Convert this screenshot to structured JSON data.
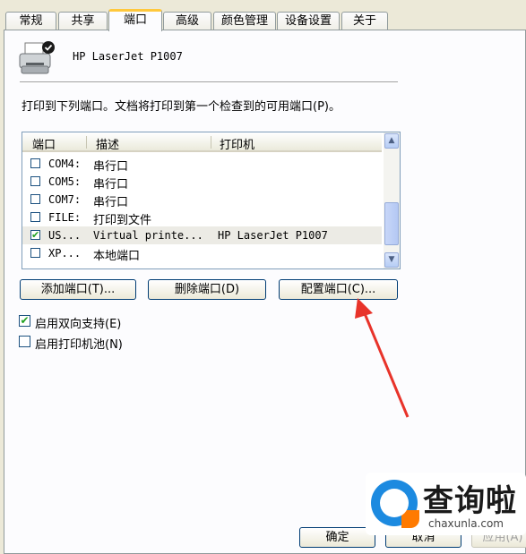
{
  "tabs": [
    {
      "label": "常规"
    },
    {
      "label": "共享"
    },
    {
      "label": "端口",
      "active": true
    },
    {
      "label": "高级"
    },
    {
      "label": "颜色管理"
    },
    {
      "label": "设备设置"
    },
    {
      "label": "关于"
    }
  ],
  "printer": {
    "name": "HP LaserJet P1007",
    "icon": "printer-icon"
  },
  "description": "打印到下列端口。文档将打印到第一个检查到的可用端口(P)。",
  "port_list": {
    "columns": [
      "端口",
      "描述",
      "打印机"
    ],
    "rows": [
      {
        "checked": false,
        "port": "COM4:",
        "description": "串行口",
        "printer": ""
      },
      {
        "checked": false,
        "port": "COM5:",
        "description": "串行口",
        "printer": ""
      },
      {
        "checked": false,
        "port": "COM7:",
        "description": "串行口",
        "printer": ""
      },
      {
        "checked": false,
        "port": "FILE:",
        "description": "打印到文件",
        "printer": ""
      },
      {
        "checked": true,
        "port": "US...",
        "description": "Virtual printe...",
        "printer": "HP LaserJet P1007"
      },
      {
        "checked": false,
        "port": "XP...",
        "description": "本地端口",
        "printer": ""
      }
    ]
  },
  "buttons": {
    "add_port": "添加端口(T)...",
    "delete_port": "删除端口(D)",
    "configure_port": "配置端口(C)..."
  },
  "options": {
    "bidirectional": {
      "label": "启用双向支持(E)",
      "checked": true
    },
    "pooling": {
      "label": "启用打印机池(N)",
      "checked": false
    }
  },
  "footer": {
    "ok": "确定",
    "cancel": "取消",
    "apply": "应用(A)"
  },
  "watermark": {
    "text_cn": "查询啦",
    "text_en": "chaxunla.com"
  },
  "annotation": {
    "arrow_color": "#e8332a"
  }
}
